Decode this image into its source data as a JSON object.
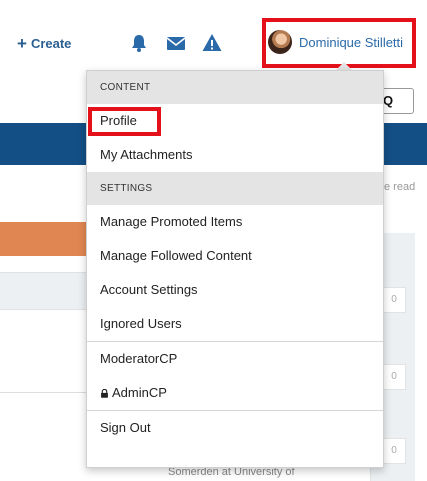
{
  "header": {
    "create_label": "Create",
    "user_name": "Dominique Stilletti",
    "icons": [
      "bell-icon",
      "envelope-icon",
      "warning-icon"
    ]
  },
  "background": {
    "read_text": "e read",
    "counts": [
      "0",
      "0",
      "0",
      "0"
    ],
    "partial_text": "Somerden at University of"
  },
  "dropdown": {
    "content_header": "CONTENT",
    "profile": "Profile",
    "my_attachments": "My Attachments",
    "settings_header": "SETTINGS",
    "manage_promoted": "Manage Promoted Items",
    "manage_followed": "Manage Followed Content",
    "account_settings": "Account Settings",
    "ignored_users": "Ignored Users",
    "moderatorcp": "ModeratorCP",
    "admincp": "AdminCP",
    "sign_out": "Sign Out"
  },
  "colors": {
    "highlight": "#e4111b",
    "nav_blue": "#134e85",
    "link_blue": "#2b6aa8",
    "orange": "#e08652"
  }
}
